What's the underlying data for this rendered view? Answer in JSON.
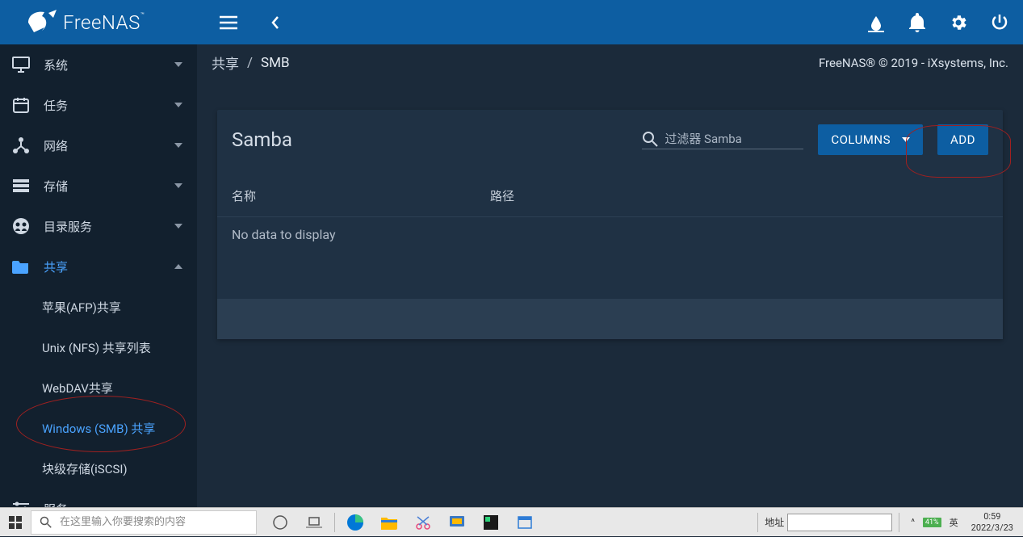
{
  "header": {
    "logo_text": "FreeNAS",
    "trademark": "™"
  },
  "breadcrumb": {
    "crumb1": "共享",
    "sep": "/",
    "crumb2": "SMB"
  },
  "copyright": "FreeNAS® © 2019 - iXsystems, Inc.",
  "sidebar": {
    "items": [
      {
        "icon": "monitor",
        "label": "系统",
        "expanded": false
      },
      {
        "icon": "calendar",
        "label": "任务",
        "expanded": false
      },
      {
        "icon": "share-nodes",
        "label": "网络",
        "expanded": false
      },
      {
        "icon": "storage",
        "label": "存储",
        "expanded": false
      },
      {
        "icon": "dir-services",
        "label": "目录服务",
        "expanded": false
      },
      {
        "icon": "folder-share",
        "label": "共享",
        "expanded": true,
        "active": true
      },
      {
        "icon": "tune",
        "label": "服务",
        "expanded": false
      }
    ],
    "sub_items": [
      {
        "label": "苹果(AFP)共享",
        "selected": false
      },
      {
        "label": "Unix (NFS) 共享列表",
        "selected": false
      },
      {
        "label": "WebDAV共享",
        "selected": false
      },
      {
        "label": "Windows (SMB) 共享",
        "selected": true
      },
      {
        "label": "块级存储(iSCSI)",
        "selected": false
      }
    ]
  },
  "card": {
    "title": "Samba",
    "filter_placeholder": "过滤器 Samba",
    "columns_btn": "COLUMNS",
    "add_btn": "ADD",
    "th_name": "名称",
    "th_path": "路径",
    "empty_text": "No data to display"
  },
  "taskbar": {
    "search_placeholder": "在这里输入你要搜索的内容",
    "addr_label": "地址",
    "tray_up": "^",
    "lang": "英",
    "battery": "41%",
    "time": "0:59",
    "date": "2022/3/23"
  }
}
